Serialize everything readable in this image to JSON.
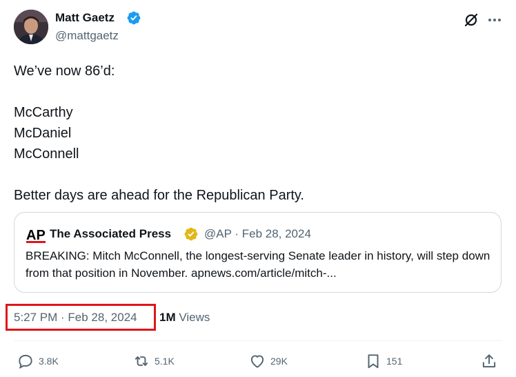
{
  "author": {
    "name": "Matt Gaetz",
    "handle": "@mattgaetz"
  },
  "tweet": {
    "lines": [
      "We’ve now 86’d:",
      "",
      "McCarthy",
      "McDaniel",
      "McConnell",
      "",
      "Better days are ahead for the Republican Party."
    ]
  },
  "quote": {
    "logo_text": "AP",
    "name": "The Associated Press",
    "meta": "@AP · Feb 28, 2024",
    "text": "BREAKING: Mitch McConnell, the longest-serving Senate leader in history, will step down from that position in November.  apnews.com/article/mitch-..."
  },
  "timestamp": "5:27 PM · Feb 28, 2024",
  "views": {
    "count": "1M",
    "label": "Views"
  },
  "actions": {
    "replies": "3.8K",
    "reposts": "5.1K",
    "likes": "29K",
    "bookmarks": "151"
  },
  "colors": {
    "verified": "#1d9bf0",
    "gold_check": "#e2b719",
    "highlight": "#e0141b",
    "secondary_text": "#536471"
  },
  "icons": [
    "verified-badge-icon",
    "grok-icon",
    "more-icon",
    "ap-logo",
    "gold-check-icon",
    "reply-icon",
    "repost-icon",
    "like-icon",
    "bookmark-icon",
    "share-icon"
  ]
}
